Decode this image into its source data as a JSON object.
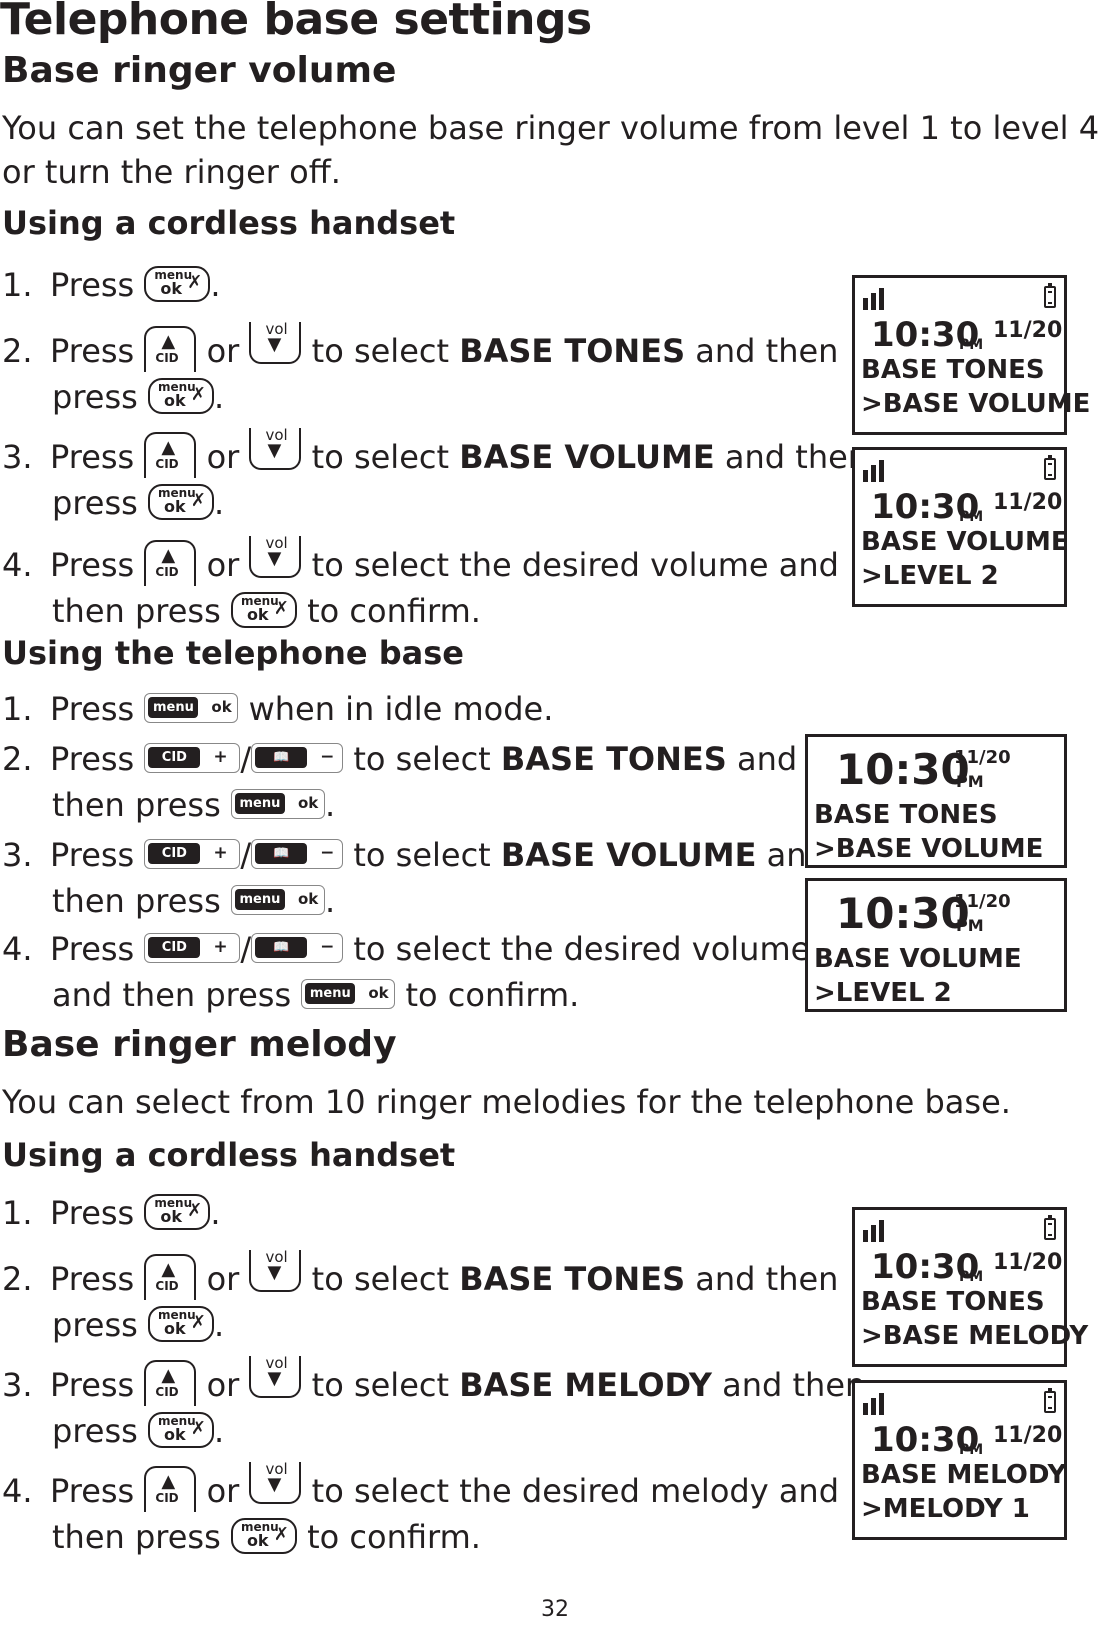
{
  "page": {
    "title": "Telephone base settings",
    "page_number": "32"
  },
  "volume": {
    "heading": "Base ringer volume",
    "intro": "You can set the telephone base ringer volume from level 1 to level 4 or turn the ringer off.",
    "handset": {
      "heading": "Using a cordless handset",
      "steps": [
        {
          "num": "1.",
          "a": "Press",
          "b": "."
        },
        {
          "num": "2.",
          "a": "Press",
          "or": "or",
          "b": "to select",
          "bold": "BASE TONES",
          "c": "and then",
          "d": "press",
          "e": "."
        },
        {
          "num": "3.",
          "a": "Press",
          "or": "or",
          "b": "to select",
          "bold": "BASE VOLUME",
          "c": "and then",
          "d": "press",
          "e": "."
        },
        {
          "num": "4.",
          "a": "Press",
          "or": "or",
          "b": "to select the desired volume and",
          "d": "then press",
          "e": "to confirm."
        }
      ],
      "screens": [
        {
          "time": "10:30",
          "ampm": "PM",
          "date": "11/20",
          "line1": "BASE TONES",
          "line2": ">BASE VOLUME"
        },
        {
          "time": "10:30",
          "ampm": "PM",
          "date": "11/20",
          "line1": "BASE VOLUME",
          "line2": ">LEVEL 2"
        }
      ]
    },
    "base": {
      "heading": "Using the telephone base",
      "steps": [
        {
          "num": "1.",
          "a": "Press",
          "b": "when in idle mode."
        },
        {
          "num": "2.",
          "a": "Press",
          "b": "to select",
          "bold": "BASE TONES",
          "c": "and",
          "d": "then press",
          "e": "."
        },
        {
          "num": "3.",
          "a": "Press",
          "b": "to select",
          "bold": "BASE VOLUME",
          "c": "and",
          "d": "then press",
          "e": "."
        },
        {
          "num": "4.",
          "a": "Press",
          "b": "to select the desired volume",
          "d": "and then press",
          "e": "to confirm."
        }
      ],
      "screens": [
        {
          "time": "10:30",
          "ampm": "PM",
          "date": "11/20",
          "line1": "BASE TONES",
          "line2": ">BASE VOLUME"
        },
        {
          "time": "10:30",
          "ampm": "PM",
          "date": "11/20",
          "line1": "BASE VOLUME",
          "line2": ">LEVEL 2"
        }
      ]
    }
  },
  "melody": {
    "heading": "Base ringer melody",
    "intro": "You can select from 10 ringer melodies for the telephone base.",
    "handset": {
      "heading": "Using a cordless handset",
      "steps": [
        {
          "num": "1.",
          "a": "Press",
          "b": "."
        },
        {
          "num": "2.",
          "a": "Press",
          "or": "or",
          "b": "to select",
          "bold": "BASE TONES",
          "c": "and then",
          "d": "press",
          "e": "."
        },
        {
          "num": "3.",
          "a": "Press",
          "or": "or",
          "b": "to select",
          "bold": "BASE MELODY",
          "c": "and then",
          "d": "press",
          "e": "."
        },
        {
          "num": "4.",
          "a": "Press",
          "or": "or",
          "b": "to select the desired melody and",
          "d": "then press",
          "e": "to confirm."
        }
      ],
      "screens": [
        {
          "time": "10:30",
          "ampm": "PM",
          "date": "11/20",
          "line1": "BASE TONES",
          "line2": ">BASE MELODY"
        },
        {
          "time": "10:30",
          "ampm": "PM",
          "date": "11/20",
          "line1": "BASE MELODY",
          "line2": ">MELODY 1"
        }
      ]
    }
  },
  "keys": {
    "menu_top": "menu",
    "menu_ok": "ok",
    "mute_glyph": "✗",
    "cid_label": "CID",
    "cid_glyph": "▲",
    "vol_label": "vol",
    "vol_glyph": "▼",
    "base_menu": "menu",
    "base_ok": "ok",
    "base_cid": "CID",
    "plus": "+",
    "book_glyph": "📖",
    "minus": "−",
    "slash": "/"
  }
}
